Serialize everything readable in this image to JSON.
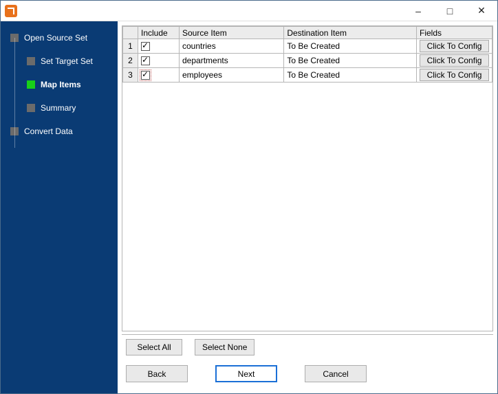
{
  "window": {
    "title": ""
  },
  "sidebar": {
    "items": [
      {
        "label": "Open Source Set",
        "active": false,
        "indent": 14
      },
      {
        "label": "Set Target Set",
        "active": false,
        "indent": 38
      },
      {
        "label": "Map Items",
        "active": true,
        "indent": 38
      },
      {
        "label": "Summary",
        "active": false,
        "indent": 38
      },
      {
        "label": "Convert Data",
        "active": false,
        "indent": 14
      }
    ]
  },
  "grid": {
    "headers": {
      "include": "Include",
      "source": "Source Item",
      "destination": "Destination Item",
      "fields": "Fields"
    },
    "rows": [
      {
        "n": "1",
        "include": true,
        "source": "countries",
        "destination": "To Be Created",
        "fields_btn": "Click To Config"
      },
      {
        "n": "2",
        "include": true,
        "source": "departments",
        "destination": "To Be Created",
        "fields_btn": "Click To Config"
      },
      {
        "n": "3",
        "include": true,
        "source": "employees",
        "destination": "To Be Created",
        "fields_btn": "Click To Config"
      }
    ]
  },
  "buttons": {
    "select_all": "Select All",
    "select_none": "Select None",
    "back": "Back",
    "next": "Next",
    "cancel": "Cancel"
  }
}
